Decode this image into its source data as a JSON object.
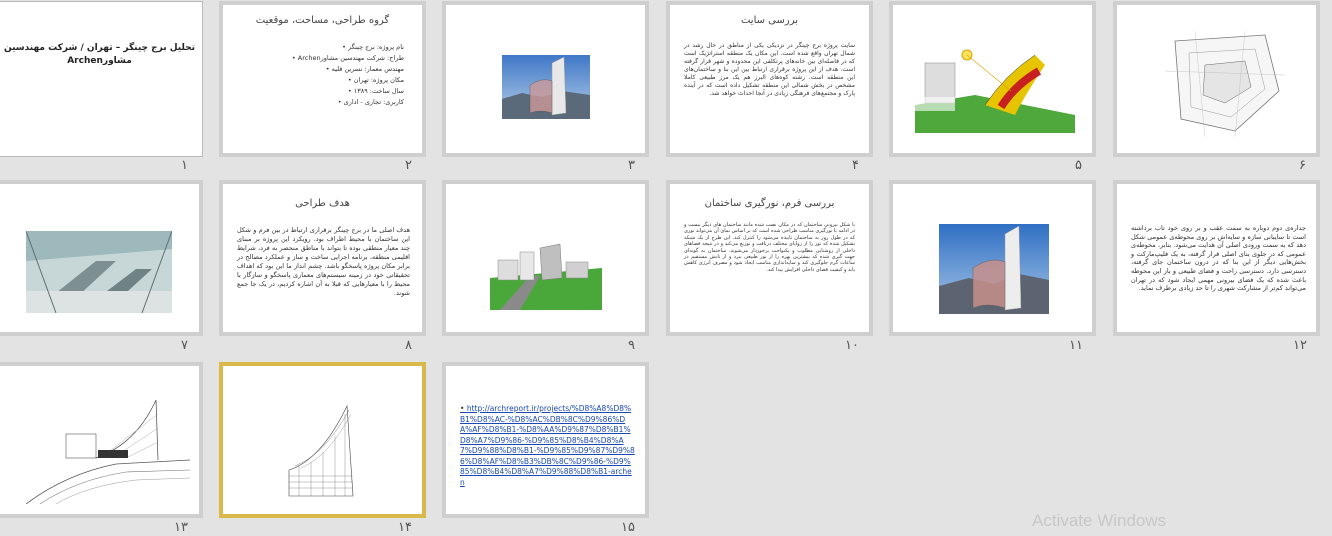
{
  "slides": [
    {
      "num": "١",
      "title": "تحلیل برج چینگر – تهران / شرکت مهندسین مشاورArchen"
    },
    {
      "num": "٢",
      "title": "گروه طراحی، مساحت، موقعیت",
      "bullets": [
        "نام پروژه: برج چینگر",
        "طراح: شرکت مهندسین مشاورArchen",
        "مهندس معمار: نسرین قلیه",
        "مکان پروژه: تهران",
        "سال ساخت: ١٣٨٩",
        "کاربری: تجاری - اداری"
      ]
    },
    {
      "num": "٣",
      "image": "tower-photo"
    },
    {
      "num": "۴",
      "title": "بررسی سایت",
      "paragraph": "سایت پروژه برج چینگر در نزدیکی یکی از مناطق در حال رشد در شمال تهران واقع شده است. این مکان یک منطقه استراتژیک است که در فاصله‌ای بین خانه‌های پرتکلفی این محدوده و شهر قرار گرفته است. هدف از این پروژه برقراری ارتباط بین این بنا و ساختمان‌های این منطقه است. رشته کوه‌های البرز هم یک مرز طبیعی کاملا مشخص در بخش شمالی این منطقه تشکیل داده است که در آینده پارک و مجتمع‌های فرهنگی زیادی در آنجا احداث خواهد شد."
    },
    {
      "num": "۵",
      "image": "sun-diagram"
    },
    {
      "num": "۶",
      "image": "site-plan"
    },
    {
      "num": "٧",
      "image": "interior-render"
    },
    {
      "num": "٨",
      "title": "هدف طراحی",
      "paragraph": "هدف اصلی ما در برج چینگر برقراری ارتباط در بین فرم و شکل این ساختمان با محیط اطراف بود. رویکرد این پروژه بر مبنای چند معیار منطقی بوده تا بتواند با مناطق منحصر به فرد، شرایط اقلیمی منطقه، برنامه اجرایی ساخت و ساز و عملکرد مصالح در برابر مکان پروژه پاسخگو باشد. چشم انداز ما این بود که اهداف تحقیقاتی خود در زمینه سیستم‌های معماری پاسخگو و سازگار با محیط را با معیارهایی که قبلا به آن اشاره کردیم، در یک جا جمع شوند."
    },
    {
      "num": "٩",
      "image": "site-model"
    },
    {
      "num": "١٠",
      "title": "بررسی فرم، نورگیری ساختمان",
      "paragraph": "با شکل بیرونی ساختمان که در مکان نصب شده مانند ساختمان های دیگر نیست و در ادامه با نورگیری مناسب طراحی شده است که بر اساس نمای آن می‌تواند نوری که در طول روز به ساختمان تابیده می‌شود را کنترل کند. این طرح از یک شبکه تشکیل شده که نور را از زوایای مختلف دریافت و توزیع می‌کند و در نتیجه فضاهای داخلی از روشنایی مطلوب و یکنواخت برخوردار می‌شوند. ساختمان به گونه‌ای جهت گیری شده که بیشترین بهره را از نور طبیعی ببرد و از تابش مستقیم در ساعات گرم جلوگیری کند و سایه‌اندازی مناسب ایجاد شود و مصرف انرژی کاهش یابد و کیفیت فضای داخلی افزایش پیدا کند."
    },
    {
      "num": "١١",
      "image": "tower-photo-2"
    },
    {
      "num": "١٢",
      "paragraph": "جداره‌ی دوم دوباره به سمت عقب و بر روی خود تاب برداشته است تا سایبانی سازه و سایه‌اش بر روی محوطه‌ی عمومی شکل دهد که به سمت ورودی اصلی آن هدایت می‌شود. بنابر، محوطه‌ی عمومی که در جلوی بنای اصلی قرار گرفته، به یک فلیپ‌مارکت و بخش‌هایی دیگر از این بنا که در درون ساختمان جای گرفته، دسترسی دارد. دسترسی راحت و فضای طبیعی و باز این محوطه باعث شده که یک فضای بیرونی مهمی ایجاد شود که در تهران می‌تواند کم‌تر از مشارکت شهری را تا حد زیادی برطرف نماید."
    },
    {
      "num": "١٣",
      "image": "sketch-perspective"
    },
    {
      "num": "١۴",
      "image": "wireframe-tower"
    },
    {
      "num": "١۵",
      "link": "http://archreport.ir/projects/%D8%A8%D8%B1%D8%AC-%D8%AC%DB%8C%D9%86%DA%AF%D8%B1-%D8%AA%D9%87%D8%B1%D8%A7%D9%86-%D9%85%D8%B4%D8%A7%D9%88%D8%B1-%D9%85%D9%87%D9%86%D8%AF%D8%B3%DB%8C%D9%86-%D9%85%D8%B4%D8%A7%D9%88%D8%B1-archen"
    }
  ],
  "selected_slide": "١۴",
  "watermark": "Activate Windows"
}
